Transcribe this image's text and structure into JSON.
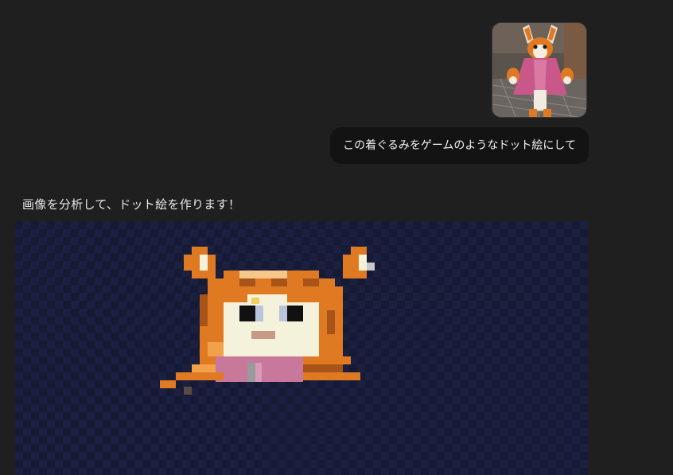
{
  "conversation": {
    "user_message": {
      "attachment": {
        "kind": "photo",
        "subject": "fursuit-photo-icon"
      },
      "text": "この着ぐるみをゲームのようなドット絵にして"
    },
    "assistant_message": {
      "text": "画像を分析して、ドット絵を作ります！",
      "artwork": {
        "kind": "pixel-art",
        "subject": "pixel-character-icon"
      }
    }
  },
  "colors": {
    "page_background": "#1f1f1f",
    "user_bubble": "#131313",
    "canvas_background": "#161a34",
    "canvas_checker": "#1b2040",
    "orange": "#e07a22",
    "dark_orange": "#a85418",
    "light_orange": "#f2a04a",
    "cream": "#f5f2dc",
    "pink": "#c8789a",
    "eye_dark": "#111111",
    "eye_blue": "#b8c4dc",
    "mouth": "#c89a86"
  }
}
